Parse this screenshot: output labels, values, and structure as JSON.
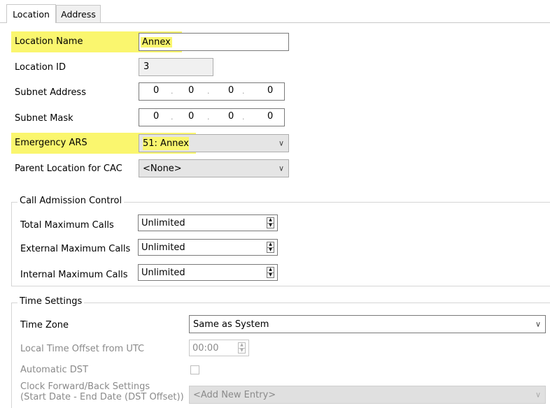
{
  "tabs": [
    {
      "label": "Location",
      "active": true
    },
    {
      "label": "Address",
      "active": false
    }
  ],
  "highlight_color": "#faf66e",
  "fields": {
    "location_name": {
      "label": "Location Name",
      "value": "Annex"
    },
    "location_id": {
      "label": "Location ID",
      "value": "3"
    },
    "subnet_address": {
      "label": "Subnet Address",
      "octets": [
        "0",
        "0",
        "0",
        "0"
      ]
    },
    "subnet_mask": {
      "label": "Subnet Mask",
      "octets": [
        "0",
        "0",
        "0",
        "0"
      ]
    },
    "emergency_ars": {
      "label": "Emergency ARS",
      "value": "51: Annex"
    },
    "parent_location": {
      "label": "Parent Location for CAC",
      "value": "<None>"
    }
  },
  "cac": {
    "title": "Call Admission Control",
    "total": {
      "label": "Total Maximum Calls",
      "value": "Unlimited"
    },
    "external": {
      "label": "External Maximum Calls",
      "value": "Unlimited"
    },
    "internal": {
      "label": "Internal Maximum Calls",
      "value": "Unlimited"
    }
  },
  "time": {
    "title": "Time Settings",
    "zone": {
      "label": "Time Zone",
      "value": "Same as System"
    },
    "offset": {
      "label": "Local Time Offset from UTC",
      "value": "00:00"
    },
    "dst": {
      "label": "Automatic DST",
      "checked": false
    },
    "clock": {
      "label_line1": "Clock Forward/Back Settings",
      "label_line2": "(Start Date - End Date (DST Offset))",
      "value": "<Add New Entry>"
    }
  }
}
